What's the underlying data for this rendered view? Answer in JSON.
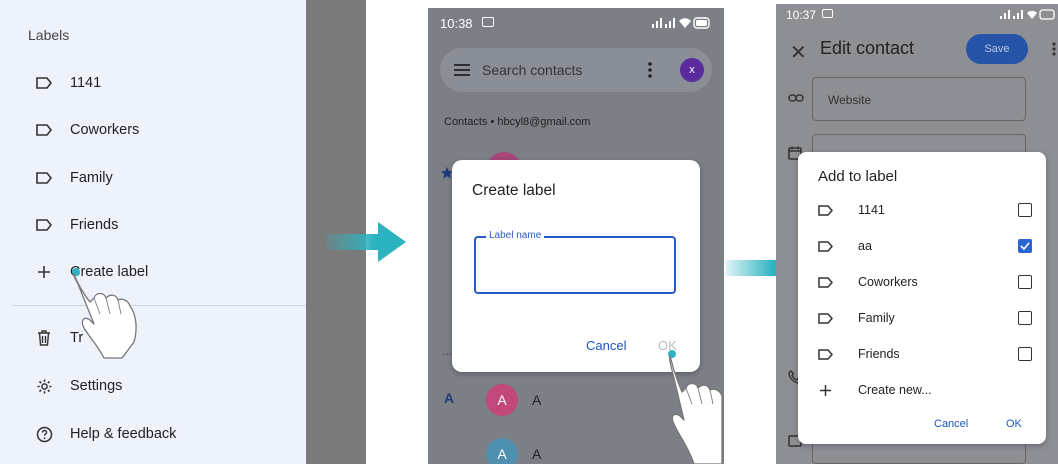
{
  "panel1": {
    "heading": "Labels",
    "labels": [
      {
        "icon": "label-icon",
        "label": "1141"
      },
      {
        "icon": "label-icon",
        "label": "Coworkers"
      },
      {
        "icon": "label-icon",
        "label": "Family"
      },
      {
        "icon": "label-icon",
        "label": "Friends"
      }
    ],
    "create_label": "Create label",
    "trash": "Tr",
    "settings": "Settings",
    "help": "Help & feedback"
  },
  "panel2": {
    "time": "10:38",
    "search_placeholder": "Search contacts",
    "avatar_letter": "x",
    "account": "Contacts • hbcyl8@gmail.com",
    "dialog": {
      "title": "Create label",
      "field_label": "Label name",
      "field_value": "",
      "cancel": "Cancel",
      "ok": "OK"
    },
    "section_letter": "A",
    "contacts": [
      {
        "initial": "A",
        "name": "A",
        "color": "#c2477a"
      },
      {
        "initial": "A",
        "name": "A",
        "color": "#4f8fb0"
      }
    ]
  },
  "panel3": {
    "time": "10:37",
    "title": "Edit contact",
    "save": "Save",
    "website_placeholder": "Website",
    "dialog": {
      "title": "Add to label",
      "items": [
        {
          "label": "1141",
          "checked": false
        },
        {
          "label": "aa",
          "checked": true
        },
        {
          "label": "Coworkers",
          "checked": false
        },
        {
          "label": "Family",
          "checked": false
        },
        {
          "label": "Friends",
          "checked": false
        }
      ],
      "create_new": "Create new...",
      "cancel": "Cancel",
      "ok": "OK"
    }
  },
  "colors": {
    "arrow": "#2bb3c0",
    "accent": "#1a56c0",
    "drawer_bg": "#eef2fb"
  }
}
